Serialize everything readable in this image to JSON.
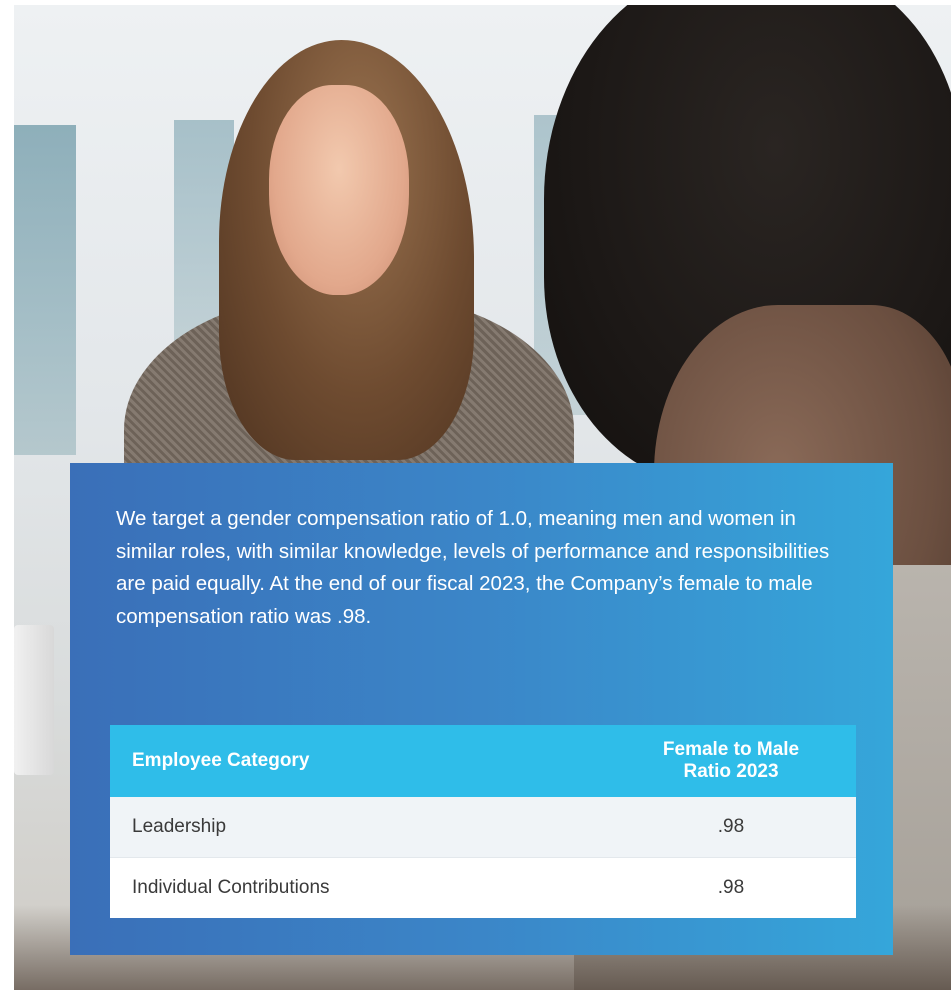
{
  "photo": {
    "description_icon": "photo-interview-scene"
  },
  "panel": {
    "text": "We target a gender compensation ratio of 1.0, meaning men and women in similar roles, with similar knowledge, levels of performance and responsibilities are paid equally. At the end of our fiscal 2023, the Company’s female to male compensation ratio was .98.",
    "colors": {
      "panel_left": "#3a6fb8",
      "panel_right": "#35a6da",
      "table_header": "#2fbde9"
    }
  },
  "table": {
    "headers": {
      "category": "Employee Category",
      "ratio_line1": "Female to Male",
      "ratio_line2": "Ratio 2023"
    },
    "rows": [
      {
        "category": "Leadership",
        "ratio": ".98"
      },
      {
        "category": "Individual Contributions",
        "ratio": ".98"
      }
    ]
  }
}
